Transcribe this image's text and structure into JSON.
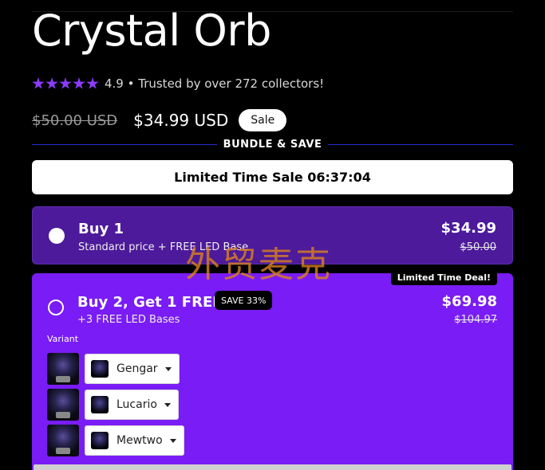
{
  "product": {
    "title": "Crystal Orb",
    "rating": "4.9",
    "rating_text": "4.9 • Trusted by over 272 collectors!",
    "old_price": "$50.00 USD",
    "price": "$34.99 USD",
    "sale_badge": "Sale"
  },
  "bundle": {
    "header": "BUNDLE & SAVE",
    "timer_text": "Limited Time Sale 06:37:04",
    "options": [
      {
        "title": "Buy 1",
        "subtitle": "Standard price + FREE LED Base",
        "price": "$34.99",
        "old_price": "$50.00",
        "selected": true
      },
      {
        "title": "Buy 2, Get 1 FREE",
        "subtitle": "+3 FREE LED Bases",
        "save_badge": "SAVE 33%",
        "deal_badge": "Limited Time Deal!",
        "price": "$69.98",
        "old_price": "$104.97",
        "selected": false,
        "variant_label": "Variant",
        "variants": [
          "Gengar",
          "Lucario",
          "Mewtwo"
        ]
      }
    ]
  },
  "watermark": "外贸麦克",
  "colors": {
    "background": "#000000",
    "star": "#8b3cff",
    "option_1_bg": "#4c1a9a",
    "option_2_bg": "#7a1cf5",
    "watermark": "#d7801f"
  }
}
